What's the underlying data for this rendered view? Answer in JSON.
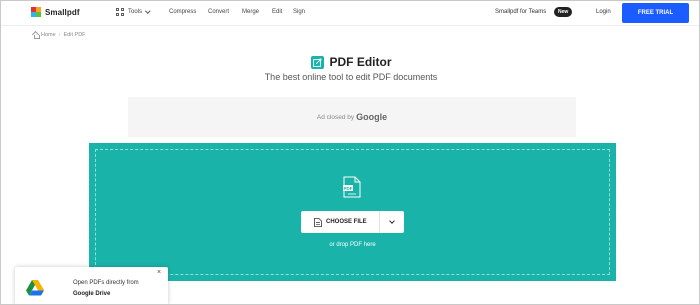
{
  "header": {
    "brand": "Smallpdf",
    "tools_label": "Tools",
    "nav": [
      "Compress",
      "Convert",
      "Merge",
      "Edit",
      "Sign"
    ],
    "teams_label": "Smallpdf for Teams",
    "new_badge": "New",
    "login_label": "Login",
    "trial_label": "FREE TRIAL"
  },
  "breadcrumb": {
    "home": "Home",
    "separator": "›",
    "current": "Edit PDF"
  },
  "hero": {
    "title": "PDF Editor",
    "subtitle": "The best online tool to edit PDF documents"
  },
  "ad": {
    "text": "Ad closed by",
    "brand": "Google"
  },
  "upload": {
    "choose_label": "CHOOSE FILE",
    "drop_hint": "or drop PDF here"
  },
  "toast": {
    "line1": "Open PDFs directly from",
    "line2": "Google Drive",
    "close": "×"
  },
  "colors": {
    "accent": "#1ab3a9",
    "primary_button": "#1a5cff",
    "badge": "#222222"
  },
  "icons": {
    "logo": "smallpdf-logo-icon",
    "tools": "grid-icon",
    "tools_caret": "chevron-down-icon",
    "home": "home-icon",
    "editor": "edit-icon",
    "file": "pdf-file-icon",
    "choose": "upload-file-icon",
    "choose_caret": "chevron-down-icon",
    "drive": "google-drive-icon"
  }
}
